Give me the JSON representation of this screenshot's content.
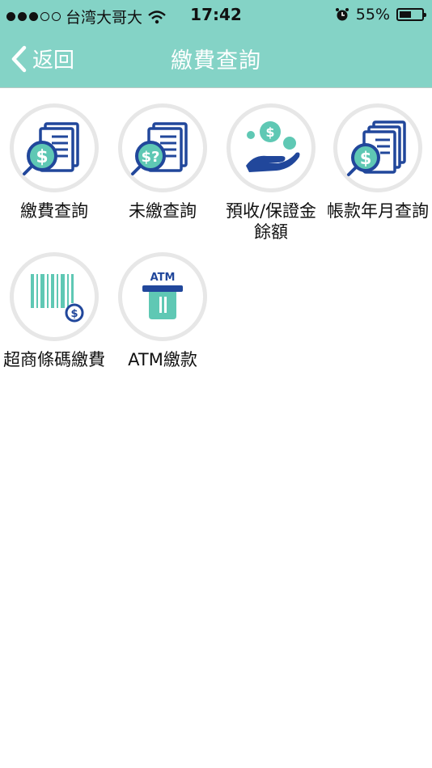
{
  "status_bar": {
    "carrier": "台湾大哥大",
    "time": "17:42",
    "battery": "55%",
    "battery_level": 0.55
  },
  "nav": {
    "back_label": "返回",
    "title": "繳費查詢"
  },
  "tiles": [
    {
      "label": "繳費查詢",
      "icon": "dollar-bill-icon"
    },
    {
      "label": "未繳查詢",
      "icon": "unpaid-query-icon"
    },
    {
      "label": "預收/保證金餘額",
      "icon": "hand-coins-icon"
    },
    {
      "label": "帳款年月查詢",
      "icon": "monthly-bill-icon"
    },
    {
      "label": "超商條碼繳費",
      "icon": "barcode-icon"
    },
    {
      "label": "ATM繳款",
      "icon": "atm-icon"
    }
  ],
  "colors": {
    "header": "#84d3c6",
    "icon_blue": "#21479b",
    "icon_teal": "#5fc8b4"
  }
}
